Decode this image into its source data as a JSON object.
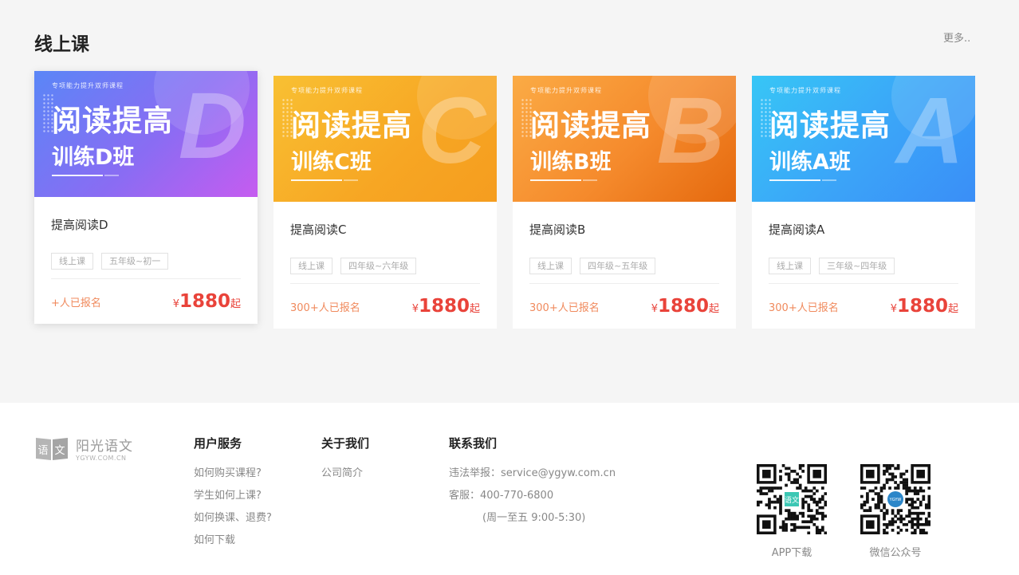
{
  "section": {
    "title": "线上课",
    "more": "更多.."
  },
  "courses": [
    {
      "banner_tagline": "专项能力提升双师课程",
      "banner_big": "阅读提高",
      "banner_small": "训练D班",
      "banner_letter": "D",
      "name": "提高阅读D",
      "tags": [
        "线上课",
        "五年级~初一"
      ],
      "enrolled": "+人已报名",
      "price_symbol": "¥",
      "price": "1880",
      "price_suffix": "起"
    },
    {
      "banner_tagline": "专项能力提升双师课程",
      "banner_big": "阅读提高",
      "banner_small": "训练C班",
      "banner_letter": "C",
      "name": "提高阅读C",
      "tags": [
        "线上课",
        "四年级~六年级"
      ],
      "enrolled": "300+人已报名",
      "price_symbol": "¥",
      "price": "1880",
      "price_suffix": "起"
    },
    {
      "banner_tagline": "专项能力提升双师课程",
      "banner_big": "阅读提高",
      "banner_small": "训练B班",
      "banner_letter": "B",
      "name": "提高阅读B",
      "tags": [
        "线上课",
        "四年级~五年级"
      ],
      "enrolled": "300+人已报名",
      "price_symbol": "¥",
      "price": "1880",
      "price_suffix": "起"
    },
    {
      "banner_tagline": "专项能力提升双师课程",
      "banner_big": "阅读提高",
      "banner_small": "训练A班",
      "banner_letter": "A",
      "name": "提高阅读A",
      "tags": [
        "线上课",
        "三年级~四年级"
      ],
      "enrolled": "300+人已报名",
      "price_symbol": "¥",
      "price": "1880",
      "price_suffix": "起"
    }
  ],
  "footer": {
    "logo": {
      "mark_chars": [
        "语",
        "文"
      ],
      "name": "阳光语文",
      "url": "YGYW.COM.CN"
    },
    "user_service": {
      "title": "用户服务",
      "links": [
        "如何购买课程?",
        "学生如何上课?",
        "如何换课、退费?",
        "如何下载"
      ]
    },
    "about": {
      "title": "关于我们",
      "links": [
        "公司简介"
      ]
    },
    "contact": {
      "title": "联系我们",
      "report": "违法举报：service@ygyw.com.cn",
      "phone": "客服：400-770-6800",
      "hours": "(周一至五 9:00-5:30)"
    },
    "qr_codes": [
      {
        "label": "APP下载",
        "center_text": "语文",
        "center_color": "#3cc7b4"
      },
      {
        "label": "微信公众号",
        "center_text": "YGYW",
        "center_color": "#2b86c9"
      }
    ]
  },
  "colors": {
    "price": "#e9433a",
    "enrolled": "#f08a5d",
    "page_bg": "#f5f5f5"
  }
}
